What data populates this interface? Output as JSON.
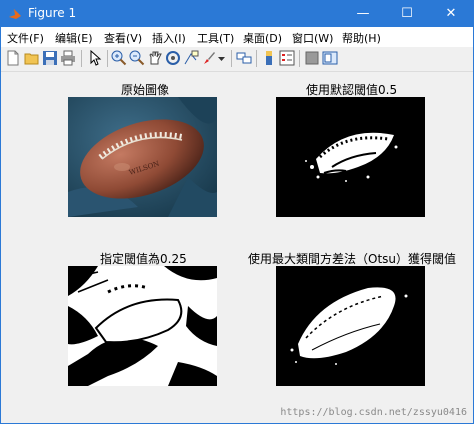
{
  "window": {
    "title": "Figure 1"
  },
  "controls": {
    "minimize": "—",
    "maximize": "☐",
    "close": "✕"
  },
  "menu": [
    {
      "label": "文件(F)"
    },
    {
      "label": "编辑(E)"
    },
    {
      "label": "查看(V)"
    },
    {
      "label": "插入(I)"
    },
    {
      "label": "工具(T)"
    },
    {
      "label": "桌面(D)"
    },
    {
      "label": "窗口(W)"
    },
    {
      "label": "帮助(H)"
    }
  ],
  "toolbar": {
    "icons": [
      "new-figure-icon",
      "open-file-icon",
      "save-icon",
      "print-icon",
      "pointer-icon",
      "zoom-in-icon",
      "zoom-out-icon",
      "pan-icon",
      "rotate-3d-icon",
      "data-cursor-icon",
      "brush-icon",
      "dropdown-arrow-icon",
      "link-plot-icon",
      "colorbar-icon",
      "legend-icon",
      "hide-plot-tools-icon",
      "show-plot-tools-icon"
    ]
  },
  "subplots": [
    {
      "title": "原始圖像",
      "kind": "original"
    },
    {
      "title": "使用默認閾值0.5",
      "kind": "binary_default"
    },
    {
      "title": "指定閾值為0.25",
      "kind": "binary_low"
    },
    {
      "title": "使用最大類間方差法（Otsu）獲得閾值",
      "kind": "binary_otsu"
    }
  ],
  "watermark": "https://blog.csdn.net/zssyu0416"
}
